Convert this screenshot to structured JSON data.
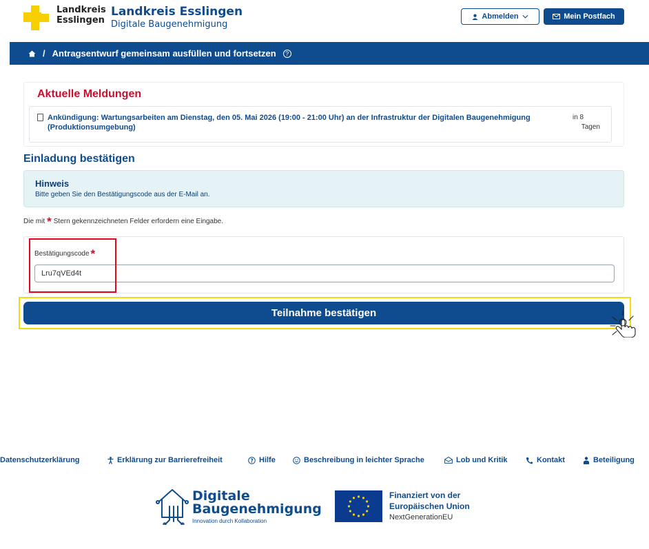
{
  "header": {
    "logo_line1": "Landkreis",
    "logo_line2": "Esslingen",
    "site_title": "Landkreis Esslingen",
    "site_subtitle": "Digitale Baugenehmigung",
    "logout_label": "Abmelden",
    "mailbox_label": "Mein Postfach"
  },
  "breadcrumb": {
    "separator": "/",
    "current": "Antragsentwurf gemeinsam ausfüllen und fortsetzen",
    "help_icon_glyph": "?"
  },
  "news": {
    "title": "Aktuelle Meldungen",
    "items": [
      {
        "text": "Ankündigung: Wartungsarbeiten am Dienstag, den 05. Mai 2026 (19:00 - 21:00 Uhr) an der Infrastruktur der Digitalen Baugenehmigung (Produktionsumgebung)",
        "meta_line1": "in 8",
        "meta_line2": "Tagen"
      }
    ]
  },
  "main": {
    "section_title": "Einladung bestätigen",
    "hint_title": "Hinweis",
    "hint_text": "Bitte geben Sie den Bestätigungscode aus der E-Mail an.",
    "required_prefix": "Die mit",
    "required_suffix": "Stern gekennzeichneten Felder erfordern eine Eingabe.",
    "asterisk": "*",
    "field_label": "Bestätigungscode",
    "field_value": "Lru7qVEd4t",
    "submit_label": "Teilnahme bestätigen"
  },
  "footer": {
    "links": [
      {
        "label": "Datenschutzerklärung",
        "icon": ""
      },
      {
        "label": "Erklärung zur Barrierefreiheit",
        "icon": "accessibility-icon"
      },
      {
        "label": "Hilfe",
        "icon": "help-circle-icon"
      },
      {
        "label": "Beschreibung in leichter Sprache",
        "icon": "smiley-icon"
      },
      {
        "label": "Lob und Kritik",
        "icon": "envelope-open-icon"
      },
      {
        "label": "Kontakt",
        "icon": "phone-icon"
      },
      {
        "label": "Beteiligung",
        "icon": "user-icon"
      }
    ],
    "logo_title_line1": "Digitale",
    "logo_title_line2": "Baugenehmigung",
    "logo_tagline": "Innovation durch Kollaboration",
    "eu_line1": "Finanziert von der",
    "eu_line2": "Europäischen Union",
    "eu_line3": "NextGenerationEU"
  },
  "colors": {
    "brand_blue": "#0f4b8f",
    "alert_red": "#c8102e",
    "logo_yellow": "#f7cf00",
    "highlight_red": "#e2061c",
    "highlight_yellow": "#f3dc0c"
  }
}
